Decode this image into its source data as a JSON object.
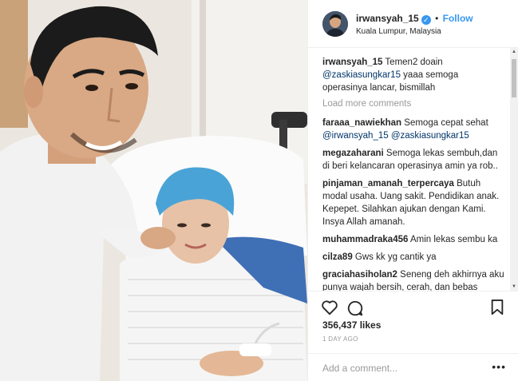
{
  "header": {
    "username": "irwansyah_15",
    "separator": "•",
    "follow_label": "Follow",
    "location": "Kuala Lumpur, Malaysia"
  },
  "caption": {
    "user": "irwansyah_15",
    "text_before": " Temen2 doain ",
    "mention": "@zaskiasungkar15",
    "text_after": " yaaa semoga operasinya lancar, bismillah"
  },
  "load_more_label": "Load more comments",
  "comments": [
    {
      "user": "faraaa_nawiekhan",
      "text": " Semoga cepat sehat ",
      "mentions": "@irwansyah_15 @zaskiasungkar15"
    },
    {
      "user": "megazaharani",
      "text": " Semoga lekas sembuh,dan di beri kelancaran operasinya amin ya rob.."
    },
    {
      "user": "pinjaman_amanah_terpercaya",
      "text": " Butuh modal usaha. Uang sakit. Pendidikan anak. Kepepet. Silahkan ajukan dengan Kami. Insya Allah amanah."
    },
    {
      "user": "muhammadraka456",
      "text": " Amin lekas sembu ka"
    },
    {
      "user": "cilza89",
      "text": " Gws kk yg cantik ya"
    },
    {
      "user": "graciahasiholan2",
      "text": " Seneng deh akhirnya aku punya wajah bersih, cerah, dan bebas jerawat.. hehehe.. thx"
    }
  ],
  "likes": "356,437 likes",
  "time_ago": "1 DAY AGO",
  "add_comment_placeholder": "Add a comment...",
  "more_options": "•••",
  "colors": {
    "link": "#3897f0",
    "mention": "#003569",
    "muted": "#999999"
  }
}
